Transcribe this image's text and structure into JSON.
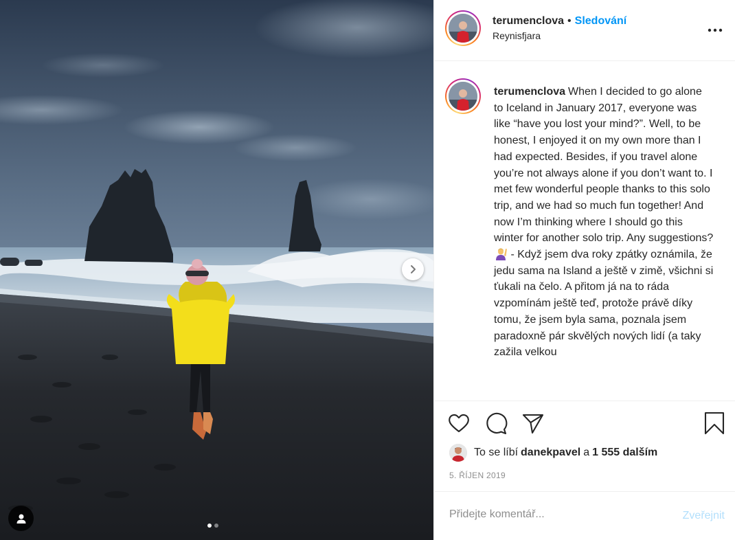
{
  "post": {
    "username": "terumenclova",
    "bullet": "•",
    "follow_label": "Sledování",
    "location": "Reynisfjara",
    "caption": "When I decided to go alone to Iceland in January 2017, everyone was like “have you lost your mind?”. Well, to be honest, I enjoyed it on my own more than I had expected. Besides, if you travel alone you’re not always alone if you don’t want to. I met few wonderful people thanks to this solo trip, and we had so much fun together! And now I’m thinking where I should go this winter for another solo trip. Any suggestions?",
    "caption_tail": " - Když jsem dva roky zpátky oznámila, že jedu sama na Island a ještě v zimě, všichni si ťukali na čelo. A přitom já na to ráda vzpomínám ještě teď, protože právě díky tomu, že jsem byla sama, poznala jsem paradoxně pár skvělých nových lidí (a taky zažila velkou",
    "likes_prefix": "To se líbí",
    "liked_by": "danekpavel",
    "likes_joiner": "a",
    "likes_others": "1 555 dalším",
    "date": "5. ŘÍJEN 2019"
  },
  "comment": {
    "placeholder": "Přidejte komentář...",
    "post_label": "Zveřejnit"
  },
  "carousel": {
    "count": 2,
    "active_index": 0
  },
  "icons": {
    "like": "heart-icon",
    "comment": "comment-bubble-icon",
    "share": "paper-plane-icon",
    "save": "bookmark-icon",
    "more": "ellipsis-icon",
    "next": "chevron-right-icon",
    "tags": "user-silhouette-icon",
    "emoji": "person-raising-hand-emoji"
  },
  "colors": {
    "follow": "#0095f6",
    "post_disabled": "#b2dffc",
    "muted": "#8e8e8e",
    "text": "#262626",
    "jacket": "#f3de1b"
  }
}
